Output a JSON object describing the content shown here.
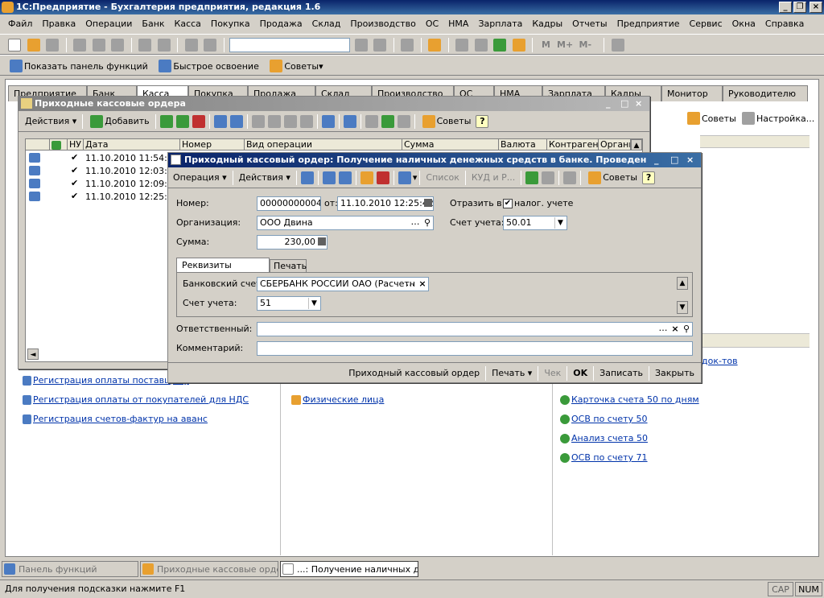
{
  "app": {
    "title": "1С:Предприятие - Бухгалтерия предприятия, редакция 1.6"
  },
  "menu": [
    "Файл",
    "Правка",
    "Операции",
    "Банк",
    "Касса",
    "Покупка",
    "Продажа",
    "Склад",
    "Производство",
    "ОС",
    "НМА",
    "Зарплата",
    "Кадры",
    "Отчеты",
    "Предприятие",
    "Сервис",
    "Окна",
    "Справка"
  ],
  "toolbar2": {
    "show_panel": "Показать панель функций",
    "quick_learn": "Быстрое освоение",
    "tips": "Советы"
  },
  "panel_tabs": [
    "Предприятие",
    "Банк",
    "Касса",
    "Покупка",
    "Продажа",
    "Склад",
    "Производство",
    "ОС",
    "НМА",
    "Зарплата",
    "Кадры",
    "Монитор",
    "Руководителю"
  ],
  "right_tools": {
    "tips": "Советы",
    "settings": "Настройка..."
  },
  "links_left": [
    "Регистрация оплаты поставщику",
    "Регистрация оплаты от покупателей для НДС",
    "Регистрация счетов-фактур на аванс"
  ],
  "links_mid": [
    "Физические лица"
  ],
  "links_right": [
    "док-тов",
    "Карточка счета 50 по дням",
    "ОСВ по счету 50",
    "Анализ счета 50",
    "ОСВ по счету 71"
  ],
  "list_window": {
    "title": "Приходные кассовые ордера",
    "actions": "Действия",
    "add": "Добавить",
    "tips": "Советы",
    "columns": [
      "НУ",
      "Дата",
      "Номер",
      "Вид операции",
      "Сумма",
      "Валюта",
      "Контраген...",
      "Органи"
    ],
    "rows": [
      {
        "date": "11.10.2010 11:54:51"
      },
      {
        "date": "11.10.2010 12:03:21"
      },
      {
        "date": "11.10.2010 12:09:45"
      },
      {
        "date": "11.10.2010 12:25:42"
      }
    ]
  },
  "doc_window": {
    "title": "Приходный кассовый ордер: Получение наличных денежных средств в банке. Проведен",
    "op_menu": "Операция",
    "actions": "Действия",
    "list_btn": "Список",
    "kudir_btn": "КУД и Р...",
    "tips": "Советы",
    "number_label": "Номер:",
    "number": "00000000004",
    "from_label": "от:",
    "date": "11.10.2010 12:25:42",
    "reflect_label": "Отразить в:",
    "tax_label": "налог. учете",
    "org_label": "Организация:",
    "org": "ООО Двина",
    "account_label": "Счет учета:",
    "account": "50.01",
    "sum_label": "Сумма:",
    "sum": "230,00",
    "tab_details": "Реквизиты платежа",
    "tab_print": "Печать",
    "bank_label": "Банковский счет:",
    "bank": "СБЕРБАНК РОССИИ ОАО (Расчетн",
    "acc2_label": "Счет учета:",
    "acc2": "51",
    "resp_label": "Ответственный:",
    "resp": "",
    "comment_label": "Комментарий:",
    "comment": "",
    "btn_pko": "Приходный кассовый ордер",
    "btn_print": "Печать",
    "btn_check": "Чек",
    "btn_ok": "OK",
    "btn_save": "Записать",
    "btn_close": "Закрыть"
  },
  "taskbar": [
    "Панель функций",
    "Приходные кассовые ордера",
    "...: Получение наличных ден..."
  ],
  "status": {
    "hint": "Для получения подсказки нажмите F1",
    "cap": "CAP",
    "num": "NUM"
  }
}
